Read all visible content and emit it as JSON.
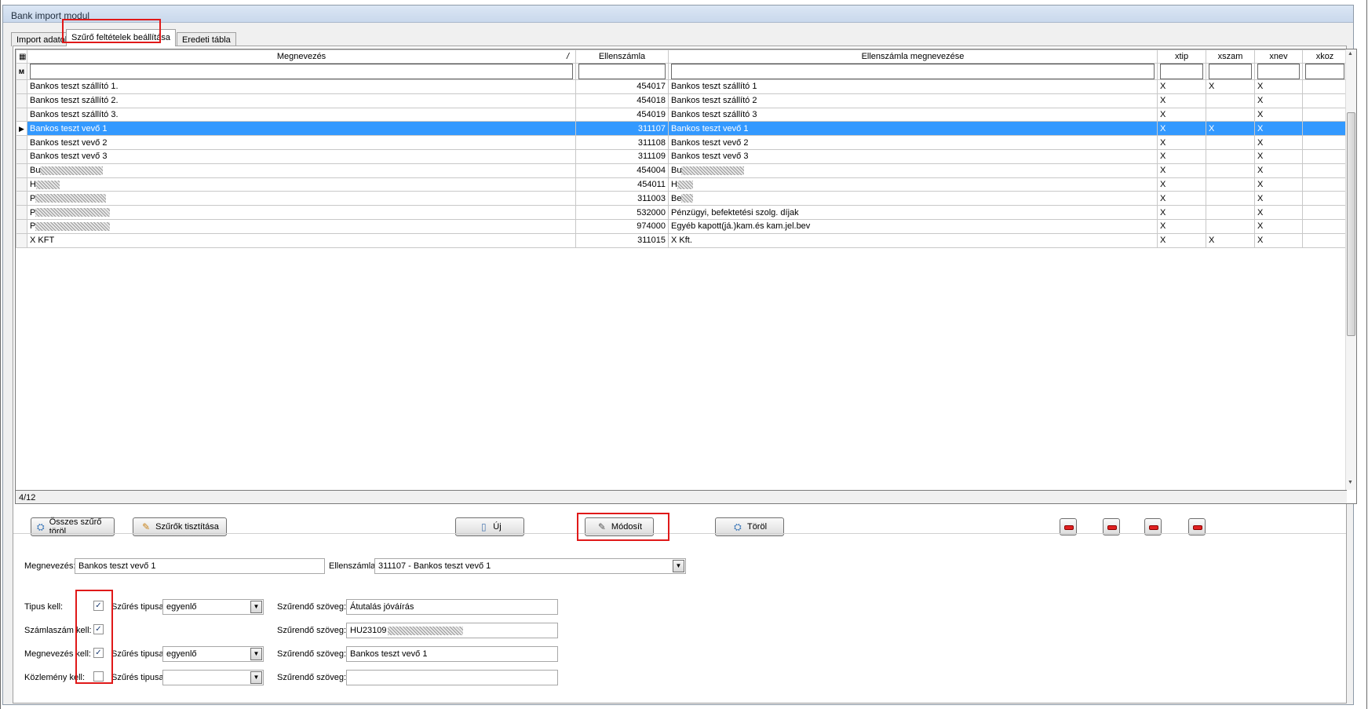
{
  "window": {
    "title": "Bank import modul"
  },
  "tabs": [
    {
      "label": "Import adatok"
    },
    {
      "label": "Szűrő feltételek beállítása"
    },
    {
      "label": "Eredeti tábla"
    }
  ],
  "grid": {
    "columns": {
      "name": "Megnevezés",
      "account": "Ellenszámla",
      "account_name": "Ellenszámla megnevezése",
      "xtip": "xtip",
      "xszam": "xszam",
      "xnev": "xnev",
      "xkoz": "xkoz"
    },
    "sort_glyph": "/",
    "rows": [
      {
        "name": "Bankos teszt szállító 1.",
        "account": "454017",
        "account_name": "Bankos teszt szállító 1",
        "xtip": "X",
        "xszam": "X",
        "xnev": "X",
        "xkoz": ""
      },
      {
        "name": "Bankos teszt szállító 2.",
        "account": "454018",
        "account_name": "Bankos teszt szállító 2",
        "xtip": "X",
        "xszam": "",
        "xnev": "X",
        "xkoz": ""
      },
      {
        "name": "Bankos teszt szállító 3.",
        "account": "454019",
        "account_name": "Bankos teszt szállító 3",
        "xtip": "X",
        "xszam": "",
        "xnev": "X",
        "xkoz": ""
      },
      {
        "name": "Bankos teszt vevő 1",
        "account": "311107",
        "account_name": "Bankos teszt vevő 1",
        "xtip": "X",
        "xszam": "X",
        "xnev": "X",
        "xkoz": ""
      },
      {
        "name": "Bankos teszt vevő 2",
        "account": "311108",
        "account_name": "Bankos teszt vevő 2",
        "xtip": "X",
        "xszam": "",
        "xnev": "X",
        "xkoz": ""
      },
      {
        "name": "Bankos teszt vevő 3",
        "account": "311109",
        "account_name": "Bankos teszt vevő 3",
        "xtip": "X",
        "xszam": "",
        "xnev": "X",
        "xkoz": ""
      },
      {
        "name": "Bu",
        "account": "454004",
        "account_name": "Bu",
        "xtip": "X",
        "xszam": "",
        "xnev": "X",
        "xkoz": ""
      },
      {
        "name": "H",
        "account": "454011",
        "account_name": "H",
        "xtip": "X",
        "xszam": "",
        "xnev": "X",
        "xkoz": ""
      },
      {
        "name": "P",
        "account": "311003",
        "account_name": "Be",
        "xtip": "X",
        "xszam": "",
        "xnev": "X",
        "xkoz": ""
      },
      {
        "name": "P",
        "account": "532000",
        "account_name": "Pénzügyi, befektetési szolg. díjak",
        "xtip": "X",
        "xszam": "",
        "xnev": "X",
        "xkoz": ""
      },
      {
        "name": "P",
        "account": "974000",
        "account_name": "Egyéb kapott(já.)kam.és kam.jel.bev",
        "xtip": "X",
        "xszam": "",
        "xnev": "X",
        "xkoz": ""
      },
      {
        "name": "X KFT",
        "account": "311015",
        "account_name": "X Kft.",
        "xtip": "X",
        "xszam": "X",
        "xnev": "X",
        "xkoz": ""
      }
    ],
    "selected_row": 3,
    "record_counter": "4/12"
  },
  "buttons": {
    "clear_all_filters": "Összes szűrő töröl",
    "clean_filters": "Szűrők tisztítása",
    "new": "Új",
    "modify": "Módosít",
    "delete": "Töröl"
  },
  "form": {
    "name_label": "Megnevezés:",
    "name_value": "Bankos teszt vevő 1",
    "account_label": "Ellenszámla:",
    "account_value": "311107 - Bankos teszt vevő 1",
    "type_needed_label": "Tipus kell:",
    "account_number_needed_label": "Számlaszám kell:",
    "name_needed_label": "Megnevezés kell:",
    "memo_needed_label": "Közlemény kell:",
    "filter_type_label": "Szűrés tipusa:",
    "filter_text_label": "Szűrendő szöveg:",
    "type_filter_type": "egyenlő",
    "name_filter_type": "egyenlő",
    "memo_filter_type": "",
    "type_filter_text": "Átutalás jóváírás",
    "account_filter_text": "HU23109",
    "name_filter_text": "Bankos teszt vevő 1",
    "memo_filter_text": "",
    "checked_mark": "✓"
  },
  "icons": {
    "grid_corner_top": "grid-settings-icon",
    "grid_corner_filter": "binoculars-icon",
    "row_indicator": "row-pointer-icon"
  },
  "colors": {
    "selection": "#3399ff",
    "highlight": "#e01919"
  }
}
